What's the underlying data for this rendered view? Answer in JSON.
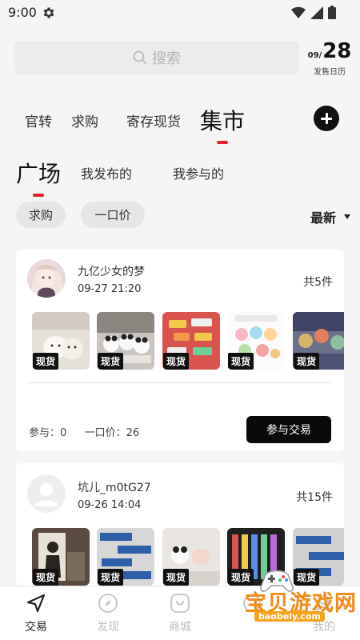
{
  "status": {
    "time": "9:00",
    "icons": [
      "gear-icon",
      "wifi-icon",
      "signal-icon",
      "battery-icon"
    ]
  },
  "search": {
    "placeholder": "搜索",
    "icon": "search-icon"
  },
  "calendar": {
    "month": "09/",
    "day": "28",
    "label": "发售日历"
  },
  "main_tabs": [
    {
      "label": "官转",
      "active": false
    },
    {
      "label": "求购",
      "active": false
    },
    {
      "label": "寄存现货",
      "active": false
    },
    {
      "label": "集市",
      "active": true
    }
  ],
  "sub_tabs": [
    {
      "label": "广场",
      "active": true
    },
    {
      "label": "我发布的",
      "active": false
    },
    {
      "label": "我参与的",
      "active": false
    }
  ],
  "filters": [
    {
      "label": "求购"
    },
    {
      "label": "一口价"
    }
  ],
  "sort": {
    "label": "最新"
  },
  "listings": [
    {
      "user": "九亿少女的梦",
      "time": "09-27 21:20",
      "count": "共5件",
      "badge": "现货",
      "participants_label": "参与：",
      "participants": "0",
      "price_label": "一口价：",
      "price": "26",
      "action": "参与交易"
    },
    {
      "user": "坑儿_m0tG27",
      "time": "09-26 14:04",
      "count": "共15件",
      "badge": "现货"
    }
  ],
  "nav": [
    {
      "label": "交易",
      "icon": "send-icon",
      "active": true
    },
    {
      "label": "发现",
      "icon": "compass-icon",
      "active": false
    },
    {
      "label": "商城",
      "icon": "shop-icon",
      "active": false
    },
    {
      "label": "",
      "icon": "",
      "active": false
    },
    {
      "label": "我的",
      "icon": "",
      "active": false
    }
  ],
  "watermark": {
    "text": "宝贝游戏网",
    "url": "baobeiy.com"
  },
  "colors": {
    "accent": "#e8202f",
    "button": "#0a0a0a",
    "background": "#f5f5f5"
  }
}
